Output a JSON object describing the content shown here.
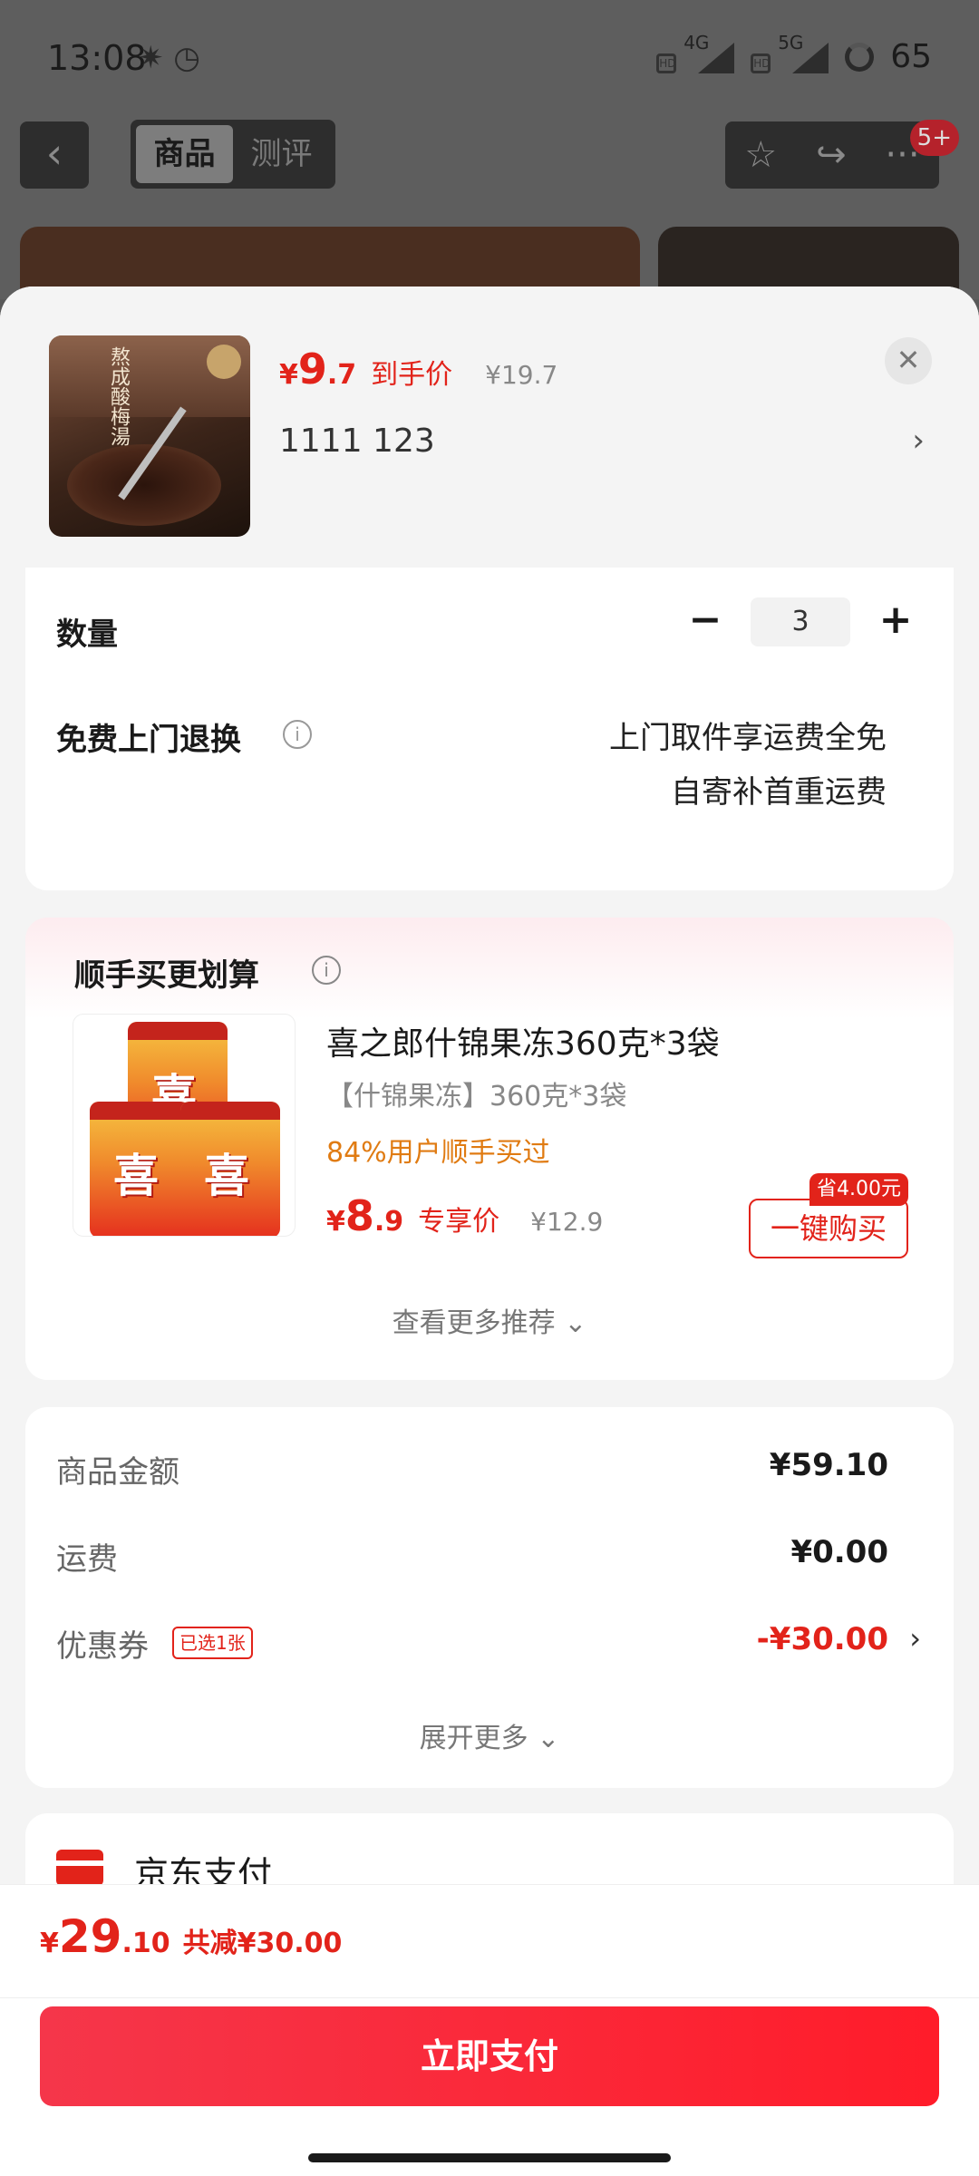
{
  "status_bar": {
    "time": "13:08",
    "net1": "4G",
    "net2": "5G",
    "battery": "65"
  },
  "top_nav": {
    "tabs": [
      "商品",
      "测评"
    ],
    "badge": "5+"
  },
  "product": {
    "currency": "¥",
    "price_int": "9",
    "price_dec": ".7",
    "price_tag": "到手价",
    "orig_price": "¥19.7",
    "spec": "1111  123",
    "thumb_text": "熬成酸梅湯"
  },
  "options": {
    "qty_label": "数量",
    "qty_value": "3",
    "minus": "−",
    "plus": "+",
    "return_label": "免费上门退换",
    "return_line1": "上门取件享运费全免",
    "return_line2": "自寄补首重运费"
  },
  "recommend": {
    "title": "顺手买更划算",
    "name": "喜之郎什锦果冻360克*3袋",
    "spec": "【什锦果冻】360克*3袋",
    "tip": "84%用户顺手买过",
    "currency": "¥",
    "price_int": "8",
    "price_dec": ".9",
    "price_tag": "专享价",
    "orig_price": "¥12.9",
    "buy_label": "一键购买",
    "save_badge": "省4.00元",
    "more": "查看更多推荐 ⌄",
    "bag_char": "喜"
  },
  "summary": {
    "goods_label": "商品金额",
    "goods_value": "¥59.10",
    "ship_label": "运费",
    "ship_value": "¥0.00",
    "coupon_label": "优惠券",
    "coupon_tag": "已选1张",
    "coupon_value": "-¥30.00",
    "expand": "展开更多 ⌄"
  },
  "payment": {
    "label": "京东支付"
  },
  "bottom": {
    "currency": "¥",
    "total_int": "29",
    "total_dec": ".10",
    "total_save": "共减¥30.00",
    "pay_button": "立即支付"
  },
  "colors": {
    "accent": "#e2231a",
    "tip": "#e07b12"
  }
}
